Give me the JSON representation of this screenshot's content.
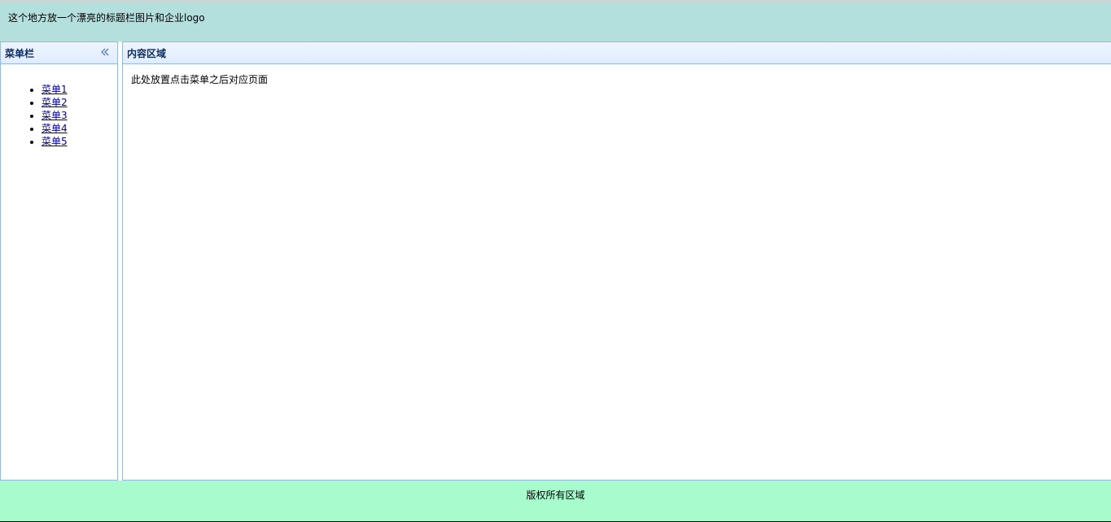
{
  "header": {
    "text": "这个地方放一个漂亮的标题栏图片和企业logo",
    "background": "#b3e0dc"
  },
  "west": {
    "title": "菜单栏",
    "collapse_icon": "double-chevron-left-icon",
    "items": [
      {
        "label": "菜单1"
      },
      {
        "label": "菜单2"
      },
      {
        "label": "菜单3"
      },
      {
        "label": "菜单4"
      },
      {
        "label": "菜单5"
      }
    ]
  },
  "center": {
    "title": "内容区域",
    "body_text": "此处放置点击菜单之后对应页面"
  },
  "footer": {
    "text": "版权所有区域",
    "background": "#a8fbcd"
  },
  "colors": {
    "panel_border": "#95b8e7",
    "panel_title": "#0e2d5f",
    "link": "#000099"
  }
}
